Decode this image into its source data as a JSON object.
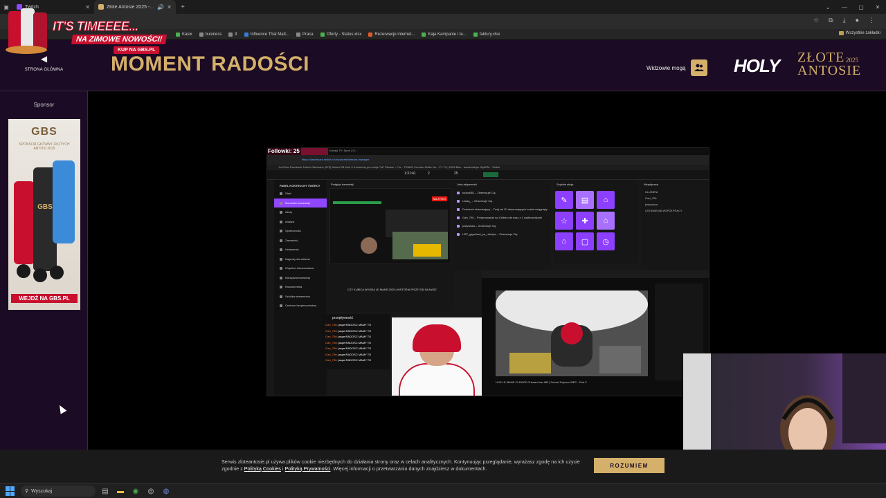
{
  "browser": {
    "tabs": [
      {
        "title": "Twitch",
        "active": false
      },
      {
        "title": "Złote Antosie 2025 - Najw",
        "active": true
      }
    ],
    "bookmarks": [
      "Kasix",
      "business",
      "tt",
      "Influence That Matt...",
      "Praca",
      "Oferty - Status.xlsx",
      "Rezerwacje internet...",
      "Kaja Kampanie i te...",
      "faktury.xlsx"
    ],
    "all_bookmarks_label": "Wszystkie zakładki"
  },
  "promo": {
    "headline": "IT'S TIMEEEE...",
    "subline": "NA ZIMOWE NOWOŚCI!",
    "cta": "KUP NA GBS.PL"
  },
  "header": {
    "home_label": "STRONA GŁÓWNA",
    "page_title": "MOMENT RADOŚCI",
    "viewers_label": "Widzowie mogą",
    "logo_holy": "HOLY",
    "logo_line1": "ZŁOTE",
    "logo_line2": "ANTOSIE",
    "logo_year": "2025"
  },
  "sidebar": {
    "sponsor_label": "Sponsor",
    "ad_brand": "GBS",
    "ad_tagline": "SPONSOR GŁÓWNY ZŁOTYCH ANTOSI 2025",
    "ad_cta": "WEJDŹ NA GBS.PL"
  },
  "stream": {
    "followers_label": "Followki: 25",
    "capture_tab": "Kanały TV: Sport | Cr...",
    "capture_url": "https://dashboard.twitch.tv/u/szymafei/stream-manager",
    "capture_bookmarks": "YouTube   Facebook   Twitch   Odebrane (573)   Steam DB   Kick   X   Konwertuj   pon.ninja   PoE Planner - For...   TRADE   Counter-Strike Ne...   F1 TV | 2025 Bas...   kanał sklepu   Styl/RM - Twitch",
    "stream_time": "1:31:41",
    "viewer_count": "2",
    "follower_count": "25",
    "sidebar_header": "PANEL KONTROLNY TWÓRCY",
    "sidebar_items": [
      "Start",
      "Menedżer transmisji",
      "Alerty",
      "Analiza",
      "Społeczność",
      "Zawartość",
      "Ustawienia",
      "Nagrody dla widzów",
      "Wspólne streamowanie",
      "Narzędzia transmisji",
      "Rozszerzenia",
      "Szkółka streamerów",
      "Centrum bezpieczeństwa"
    ],
    "preview_header": "Podgląd transmisji",
    "preview_live": "NA ŻYWO",
    "preview_title": "CZY KUBICA WYGRA LE MANS 2025 | HISTORIA PISZE SIĘ NA NASZ",
    "activity_header": "Lista aktywności",
    "activity_items": [
      "kozka681 – Obserwuje Cię",
      "Lisiaq_ – Obserwuje Cię",
      "Dziedmot obserwujący – Twój cel 30 obserwujących został osiągnięty",
      "Gari_756 – Przeprowadził na Ciebie raid wraz z 2 użytkownikami",
      "justyniasa – Obserwuje Cię",
      "HZP_gigachad_po_nilsdym – Obserwuje Cię"
    ],
    "quick_header": "Szybkie akcje",
    "quick_icons": [
      "✎",
      "▤",
      "⌂",
      "☆",
      "✚",
      "⌂",
      "⌂",
      "▢",
      "◷"
    ],
    "collab_header": "Współpraca",
    "collab_items": [
      "ULUBIENI",
      "Gari_756",
      "justyniasa",
      "USTAWIENIA WSPÓŁPRACY"
    ],
    "chat_header": "przepływność",
    "chat_lines": [
      {
        "user": "Gari_756",
        "msg": "jasperRADOSC MAMY TO"
      },
      {
        "user": "Gari_756",
        "msg": "jasperRADOSC MAMY TO"
      },
      {
        "user": "Gari_756",
        "msg": "jasperRADOSC MAMY TO"
      },
      {
        "user": "Gari_756",
        "msg": "jasperRADOSC MAMY TO"
      },
      {
        "user": "Gari_756",
        "msg": "jasperRADOSC MAMY TO"
      },
      {
        "user": "Gari_756",
        "msg": "jasperRADOSC MAMY TO"
      },
      {
        "user": "Gari_756",
        "msg": "jasperRADOSC MAMY TO"
      }
    ],
    "second_video_title": "LIVE LE MANS 24 RACE Onboard car #83 | Ferrari Szymon WEC - Part 3"
  },
  "cookie": {
    "text_1": "Serwis zloteantosie.pl używa plików cookie niezbędnych do działania strony oraz w celach analitycznych. Kontynuując przeglądanie, wyrażasz zgodę na ich użycie zgodnie z ",
    "link_cookies": "Polityką Cookies",
    "text_and": " i ",
    "link_privacy": "Polityką Prywatności",
    "text_2": ". Więcej informacji o przetwarzaniu danych znajdziesz w dokumentach.",
    "button": "ROZUMIEM"
  },
  "taskbar": {
    "search_placeholder": "Wyszukaj"
  },
  "colors": {
    "gold": "#d4b06a",
    "site_bg": "#1b0b24",
    "twitch_purple": "#9146ff",
    "promo_red": "#c8102e"
  }
}
